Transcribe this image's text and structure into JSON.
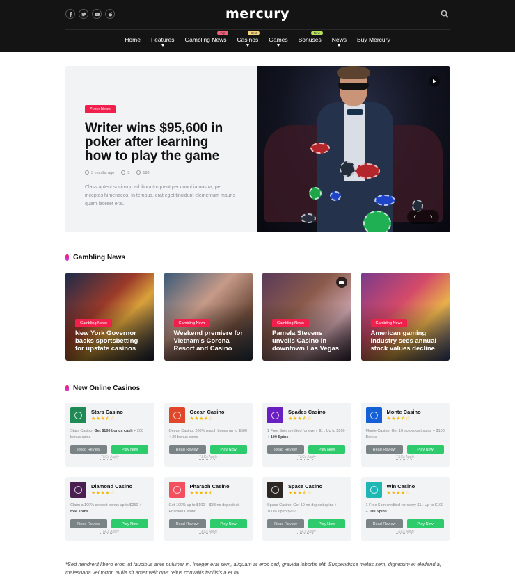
{
  "header": {
    "logo": "mercury",
    "socials": [
      "facebook-icon",
      "twitter-icon",
      "youtube-icon",
      "reddit-icon"
    ],
    "nav": [
      {
        "label": "Home",
        "caret": false,
        "badge": null
      },
      {
        "label": "Features",
        "caret": true,
        "badge": null
      },
      {
        "label": "Gambling News",
        "caret": false,
        "badge": {
          "text": "Top",
          "color": "#f0607a"
        }
      },
      {
        "label": "Casinos",
        "caret": true,
        "badge": {
          "text": "Best",
          "color": "#f3d37a"
        }
      },
      {
        "label": "Games",
        "caret": true,
        "badge": null
      },
      {
        "label": "Bonuses",
        "caret": false,
        "badge": {
          "text": "New",
          "color": "#b7e35a"
        }
      },
      {
        "label": "News",
        "caret": true,
        "badge": null
      },
      {
        "label": "Buy Mercury",
        "caret": false,
        "badge": null
      }
    ]
  },
  "hero": {
    "tag": "Poker News",
    "title": "Writer wins $95,600 in poker after learning how to play the game",
    "time": "3 months ago",
    "comments": "5",
    "views": "193",
    "excerpt": "Class aptent sociosqu ad litora torquent per conubia nostra, per inceptos himenaeos. In tempus, erat eget tincidunt elementum mauris quam laoreet erat.",
    "prev": "‹",
    "next": "›"
  },
  "gambling_news": {
    "title": "Gambling News",
    "items": [
      {
        "tag": "Gambling News",
        "title": "New York Governor backs sportsbetting for upstate casinos",
        "camera": false
      },
      {
        "tag": "Gambling News",
        "title": "Weekend premiere for Vietnam's Corona Resort and Casino",
        "camera": false
      },
      {
        "tag": "Gambling News",
        "title": "Pamela Stevens unveils Casino in downtown Las Vegas",
        "camera": true
      },
      {
        "tag": "Gambling News",
        "title": "American gaming industry sees annual stock values decline",
        "camera": false
      }
    ]
  },
  "casinos": {
    "title": "New Online Casinos",
    "review_label": "Read Review",
    "play_label": "Play Now",
    "tcs_label": "T&Cs Apply",
    "items": [
      {
        "name": "Stars Casino",
        "rating": 3.5,
        "logo_color": "#1f8a55",
        "desc_pre": "Stars Casino: ",
        "desc_bold": "Get $100 bonus cash",
        "desc_post": " + 200 bonus spins"
      },
      {
        "name": "Ocean Casino",
        "rating": 4,
        "logo_color": "#e0462a",
        "desc_pre": "Ocean Casino: 200% match bonus up to $500 + 20 bonus spins",
        "desc_bold": "",
        "desc_post": ""
      },
      {
        "name": "Spades Casino",
        "rating": 3.5,
        "logo_color": "#6a1fc2",
        "desc_pre": "1 Free Spin credited for every $1 . Up to $100 + ",
        "desc_bold": "100 Spins",
        "desc_post": ""
      },
      {
        "name": "Monte Casino",
        "rating": 3.5,
        "logo_color": "#1560d6",
        "desc_pre": "Monte Casino: Get 10 no deposit spins + $100 Bonus",
        "desc_bold": "",
        "desc_post": ""
      },
      {
        "name": "Diamond Casino",
        "rating": 4,
        "logo_color": "#4a2050",
        "desc_pre": "Claim a 100% deposit bonus up to $250 + ",
        "desc_bold": "free spins",
        "desc_post": ""
      },
      {
        "name": "Pharaoh Casino",
        "rating": 4.5,
        "logo_color": "#f2505e",
        "desc_pre": "Get 100% up to $100 + $88 no deposit at Pharaoh Casino",
        "desc_bold": "",
        "desc_post": ""
      },
      {
        "name": "Space Casino",
        "rating": 3.5,
        "logo_color": "#2b2622",
        "desc_pre": "Space Casino: Get 10 no-deposit spins + 100% up to $200",
        "desc_bold": "",
        "desc_post": ""
      },
      {
        "name": "Win Casino",
        "rating": 4,
        "logo_color": "#1fb7b4",
        "desc_pre": "1 Free Spin credited for every $1 . Up to $100 + ",
        "desc_bold": "100 Spins",
        "desc_post": ""
      }
    ]
  },
  "footnote": "*Sed hendrerit libero eros, ut faucibus ante pulvinar in. Integer erat sem, aliquam at eros sed, gravida lobortis elit. Suspendisse metus sem, dignissim et eleifend a, malesuada vel tortor. Nulla sit amet velit quis tellus convallis facilisis a et mi."
}
